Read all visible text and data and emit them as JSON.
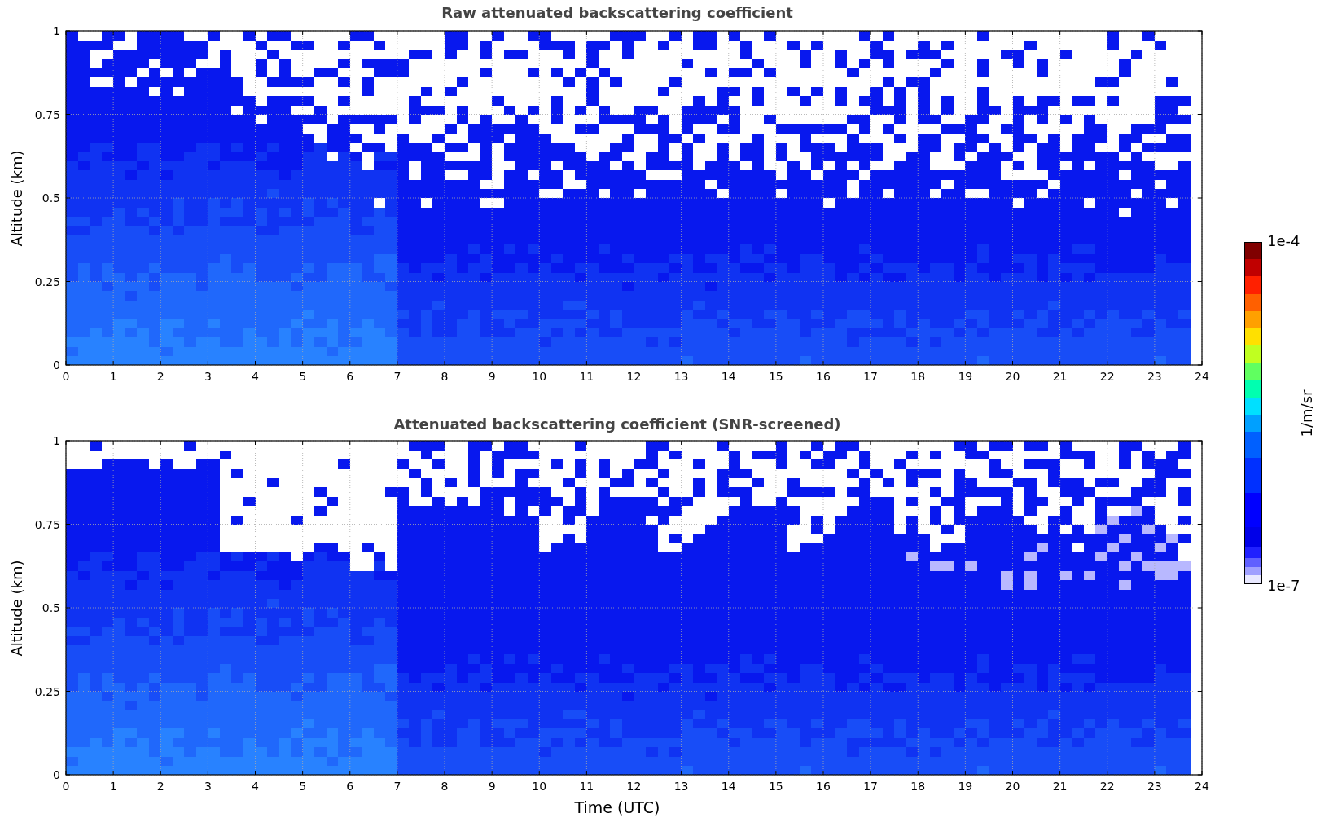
{
  "plots": [
    {
      "kind": "raw",
      "title": "Raw attenuated backscattering coefficient",
      "ylabel": "Altitude (km)",
      "yticks": [
        "1",
        "0.75",
        "0.5",
        "0.25",
        "0"
      ],
      "xticks": [
        "0",
        "1",
        "2",
        "3",
        "4",
        "5",
        "6",
        "7",
        "8",
        "9",
        "10",
        "11",
        "12",
        "13",
        "14",
        "15",
        "16",
        "17",
        "18",
        "19",
        "20",
        "21",
        "22",
        "23",
        "24"
      ]
    },
    {
      "kind": "screened",
      "title": "Attenuated backscattering coefficient (SNR-screened)",
      "ylabel": "Altitude (km)",
      "yticks": [
        "1",
        "0.75",
        "0.5",
        "0.25",
        "0"
      ],
      "xticks": [
        "0",
        "1",
        "2",
        "3",
        "4",
        "5",
        "6",
        "7",
        "8",
        "9",
        "10",
        "11",
        "12",
        "13",
        "14",
        "15",
        "16",
        "17",
        "18",
        "19",
        "20",
        "21",
        "22",
        "23",
        "24"
      ]
    }
  ],
  "xlabel": "Time (UTC)",
  "colorbar": {
    "label": "1/m/sr",
    "max": "1e-4",
    "min": "1e-7"
  }
}
